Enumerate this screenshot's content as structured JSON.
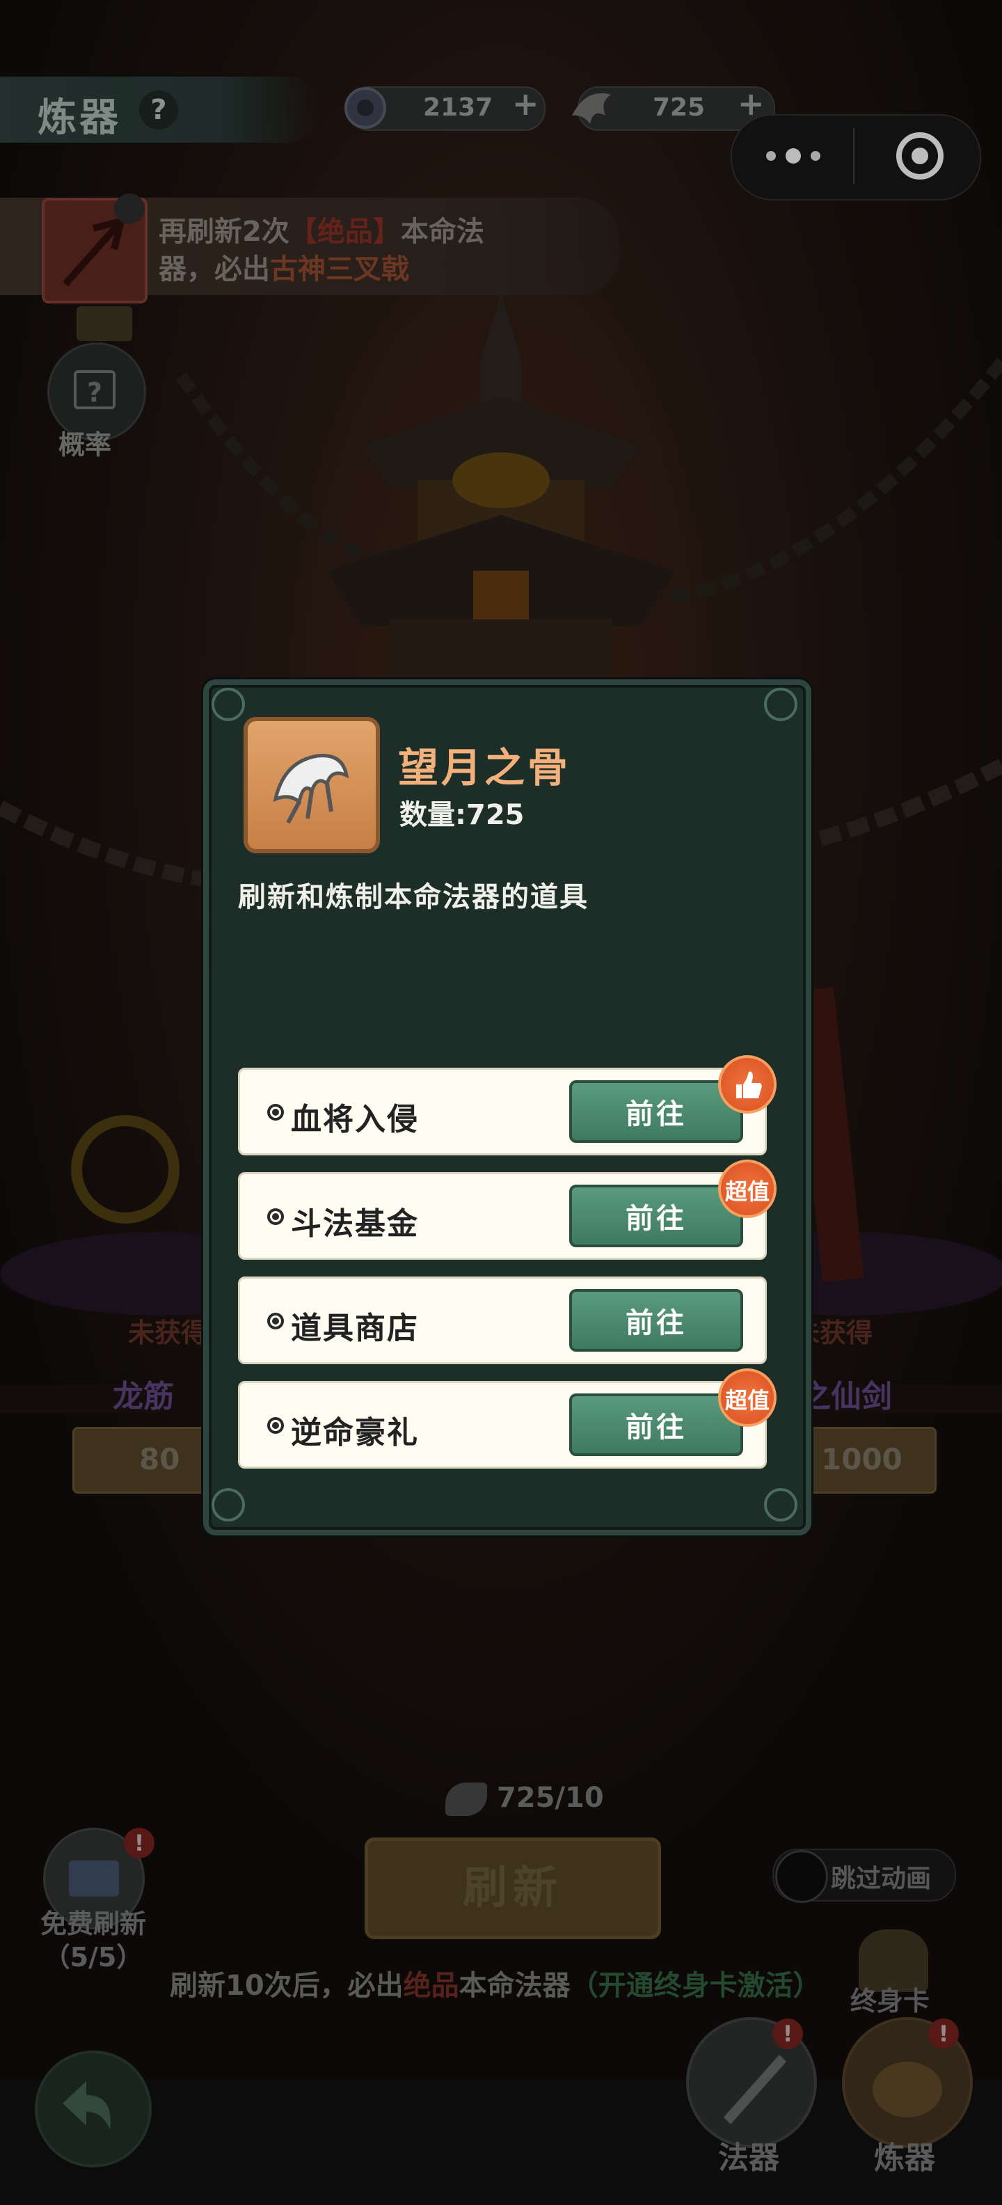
{
  "header": {
    "title": "炼器",
    "help_label": "?",
    "currency1_value": "2137",
    "currency2_value": "725",
    "plus_label": "+"
  },
  "hint": {
    "line1_prefix": "再刷新2次",
    "line1_highlight": "【绝品】",
    "line1_suffix": "本命法",
    "line2_prefix": "器，必出",
    "line2_highlight": "古神三叉戟"
  },
  "probability": {
    "label": "概率",
    "icon_glyph": "?"
  },
  "dialog": {
    "item_name": "望月之骨",
    "item_quantity": "数量:725",
    "item_description": "刷新和炼制本命法器的道具",
    "rows": [
      {
        "label": "血将入侵",
        "button": "前往",
        "badge": ""
      },
      {
        "label": "斗法基金",
        "button": "前往",
        "badge": "超值"
      },
      {
        "label": "道具商店",
        "button": "前往",
        "badge": ""
      },
      {
        "label": "逆命豪礼",
        "button": "前往",
        "badge": "超值"
      }
    ]
  },
  "background_ui": {
    "left_status": "未获得",
    "left_name": "龙筋",
    "left_cost": "80",
    "right_status": "未获得",
    "right_name": "之仙剑",
    "right_cost": "1000",
    "counter": "725/10",
    "refresh_button": "刷新",
    "skip_label": "跳过动画",
    "free_refresh_label": "免费刷新",
    "free_refresh_count": "（5/5）",
    "bottom_hint_prefix": "刷新10次后，必出",
    "bottom_hint_highlight": "绝品",
    "bottom_hint_middle": "本命法器",
    "bottom_hint_suffix": "（开通终身卡激活）",
    "lifetime_card_label": "终身卡",
    "alert_mark": "!"
  },
  "nav": {
    "fabao_label": "法器",
    "lianqi_label": "炼器"
  },
  "colors": {
    "accent_orange": "#f2b07c",
    "goto_button": "#4b8a6e",
    "badge": "#e35f2a"
  }
}
